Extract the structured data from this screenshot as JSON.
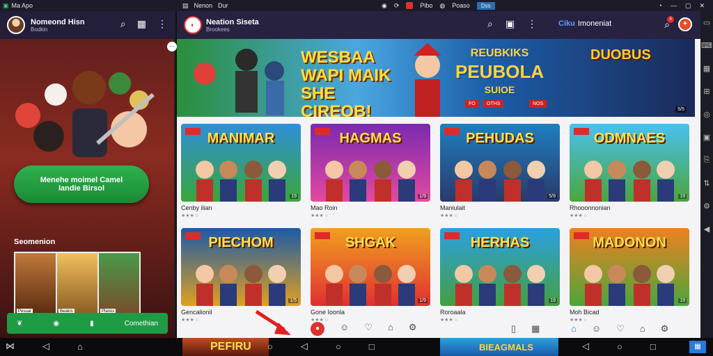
{
  "statusbar": {
    "app_name": "Ma Apo",
    "tab1": "Nenon",
    "tab2": "Dur",
    "tab3": "Pibo",
    "tab4": "Poaso",
    "active_tab": "Dss"
  },
  "left_pane": {
    "user_name": "Nomeond Hisn",
    "user_sub": "Bodkin",
    "cta_line1": "Menehe moimel Camel",
    "cta_line2": "landie Birsol",
    "section_title": "Seomenion",
    "thumbs": [
      "Pesuar",
      "Beakrs",
      "Plarios"
    ],
    "bottom_label": "Comethian"
  },
  "right_pane": {
    "app_title": "Neation Siseta",
    "app_sub": "Brookees",
    "account_brand": "Ciku",
    "account_label": "Imoneniat",
    "notif_count": "4",
    "banner": {
      "left_text": "WESBAA WAPI MAIK SHE CIREOB!",
      "center_line1": "REUBKIKS",
      "center_line2": "PEUBOLA",
      "center_line3": "SUIOE",
      "right_text": "DUOBUS",
      "badges": [
        "FO",
        "OTHS",
        "NOS"
      ],
      "page": "5/5"
    },
    "cards": [
      {
        "title": "MANIMAR",
        "name": "Cenby ilian",
        "colors": [
          "#2f8fd8",
          "#3aa63a"
        ],
        "age": "19"
      },
      {
        "title": "HAGMAS",
        "name": "Mao Roin",
        "colors": [
          "#7a2ab0",
          "#e44aa0"
        ],
        "age": "1/9"
      },
      {
        "title": "PEHUDAS",
        "name": "Maniulait",
        "colors": [
          "#1e7fc0",
          "#2a3a6a"
        ],
        "age": "5/9"
      },
      {
        "title": "ODMNAES",
        "name": "Rhooonnonian",
        "colors": [
          "#4ac0f0",
          "#4aa63a"
        ],
        "age": "19"
      },
      {
        "title": "PIECHOM",
        "name": "Gencalionil",
        "colors": [
          "#1b5aa8",
          "#e0a020"
        ],
        "age": "1/5"
      },
      {
        "title": "SHGAK",
        "name": "Gone Ioonla",
        "colors": [
          "#f0a020",
          "#e03030"
        ],
        "age": "1/9"
      },
      {
        "title": "HERHAS",
        "name": "Roroaala",
        "colors": [
          "#2aa0e0",
          "#44a040"
        ],
        "age": "19"
      },
      {
        "title": "MADONON",
        "name": "Moh Bicad",
        "colors": [
          "#f08020",
          "#4aa63a"
        ],
        "age": "19"
      }
    ]
  },
  "bottom_strip": {
    "peek1": "PEFIRU",
    "peek2": "BIEAGMALS"
  },
  "colors": {
    "header_bg": "#262240",
    "accent_green": "#1f9a45",
    "accent_red": "#e03030",
    "brand_blue": "#5aa0ff"
  }
}
